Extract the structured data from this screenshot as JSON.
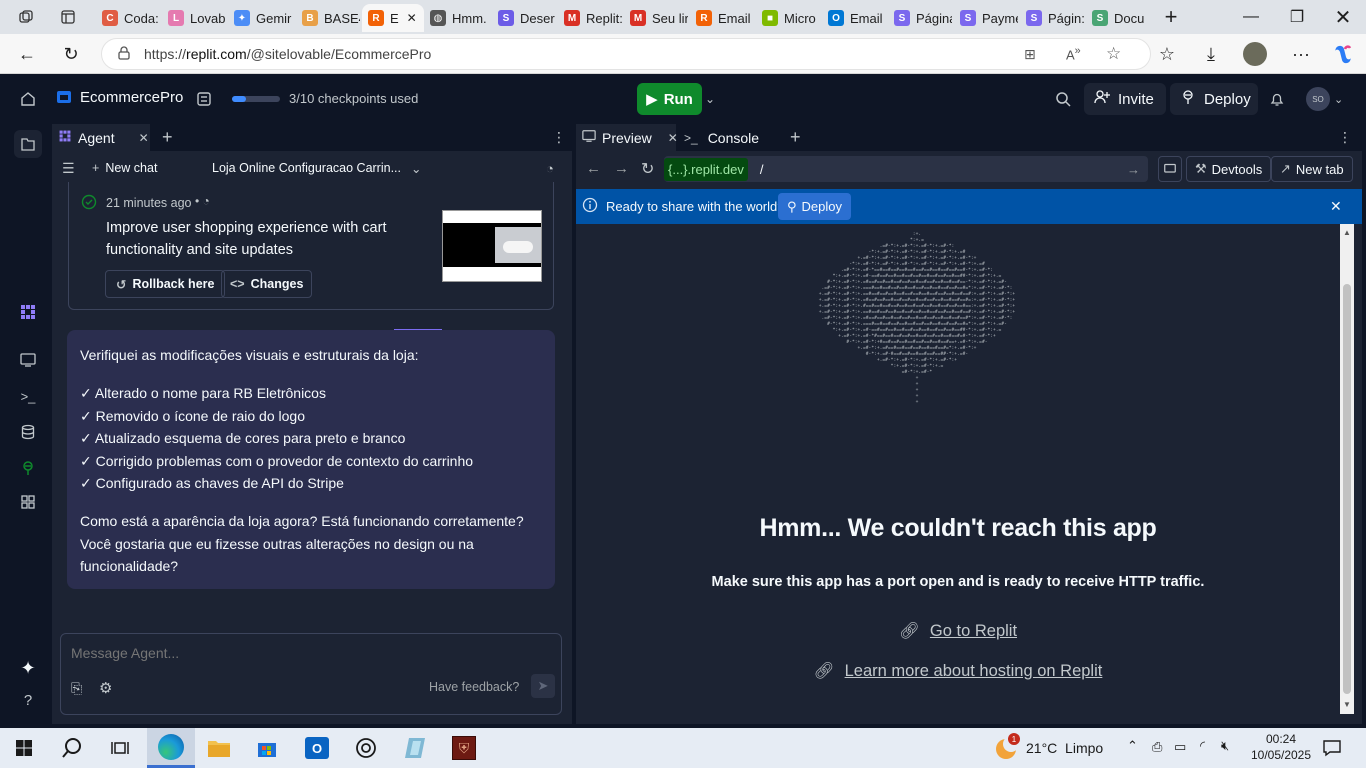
{
  "browser": {
    "tabs": [
      {
        "label": "Coda:",
        "color": "#e05d44",
        "glyph": "C"
      },
      {
        "label": "Lovab",
        "color": "#e57ab0",
        "glyph": "L"
      },
      {
        "label": "Gemir",
        "color": "#4c8df6",
        "glyph": "✦"
      },
      {
        "label": "BASE4",
        "color": "#e8a048",
        "glyph": "B"
      },
      {
        "label": "E",
        "color": "#f26207",
        "glyph": "R"
      },
      {
        "label": "Hmm.",
        "color": "#555555",
        "glyph": "◍"
      },
      {
        "label": "Deser",
        "color": "#6c5ce7",
        "glyph": "S"
      },
      {
        "label": "Replit:",
        "color": "#d93025",
        "glyph": "M"
      },
      {
        "label": "Seu lir",
        "color": "#d93025",
        "glyph": "M"
      },
      {
        "label": "Email",
        "color": "#f26207",
        "glyph": "R"
      },
      {
        "label": "Micro",
        "color": "#7fba00",
        "glyph": "■"
      },
      {
        "label": "Email",
        "color": "#0078d4",
        "glyph": "O"
      },
      {
        "label": "Página",
        "color": "#7b68ee",
        "glyph": "S"
      },
      {
        "label": "Payme",
        "color": "#7b68ee",
        "glyph": "S"
      },
      {
        "label": "Págin:",
        "color": "#7b68ee",
        "glyph": "S"
      },
      {
        "label": "Docu",
        "color": "#4aa574",
        "glyph": "S"
      }
    ],
    "url_prefix": "https://",
    "url_host": "replit.com",
    "url_path": "/@sitelovable/EcommercePro"
  },
  "replit": {
    "project_name": "EcommercePro",
    "checkpoints_label": "3/10 checkpoints used",
    "checkpoints_progress": 0.3,
    "run_label": "Run",
    "invite_label": "Invite",
    "deploy_label": "Deploy",
    "avatar_initials": "SO"
  },
  "agent": {
    "tab_label": "Agent",
    "new_chat_label": "New chat",
    "chat_title": "Loja Online Configuracao Carrin...",
    "checkpoint": {
      "time": "21 minutes ago",
      "title_line1": "Improve user shopping experience with cart",
      "title_line2": "functionality and site updates",
      "rollback_label": "Rollback here",
      "changes_label": "Changes"
    },
    "message": {
      "intro": "Verifiquei as modificações visuais e estruturais da loja:",
      "items": [
        "✓ Alterado o nome para RB Eletrônicos",
        "✓ Removido o ícone de raio do logo",
        "✓ Atualizado esquema de cores para preto e branco",
        "✓ Corrigido problemas com o provedor de contexto do carrinho",
        "✓ Configurado as chaves de API do Stripe"
      ],
      "outro_line1": "Como está a aparência da loja agora? Está funcionando corretamente?",
      "outro_line2": "Você gostaria que eu fizesse outras alterações no design ou na",
      "outro_line3": "funcionalidade?"
    },
    "composer_placeholder": "Message Agent...",
    "feedback_label": "Have feedback?"
  },
  "preview": {
    "tab_preview": "Preview",
    "tab_console": "Console",
    "domain_label": "{...}.replit.dev",
    "path_value": "/",
    "devtools_label": "Devtools",
    "new_tab_label": "New tab",
    "banner_text": "Ready to share with the world?",
    "banner_deploy": "Deploy",
    "error_title": "Hmm... We couldn't reach this app",
    "error_sub": "Make sure this app has a port open and is ready to receive HTTP traffic.",
    "link_goto": "Go to Replit",
    "link_learn": "Learn more about hosting on Replit"
  },
  "taskbar": {
    "weather": "21°C  Limpo",
    "weather_badge": "1",
    "time": "00:24",
    "date": "10/05/2025"
  }
}
